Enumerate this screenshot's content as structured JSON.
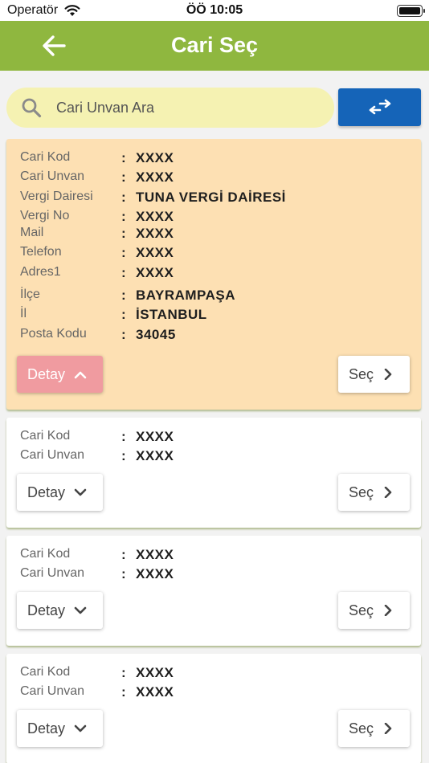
{
  "status_bar": {
    "carrier": "Operatör",
    "time": "ÖÖ 10:05"
  },
  "header": {
    "title": "Cari Seç"
  },
  "search": {
    "placeholder": "Cari Unvan Ara",
    "value": ""
  },
  "colon": ":",
  "buttons": {
    "detail": "Detay",
    "select": "Seç"
  },
  "colors": {
    "header": "#8fb73f",
    "search_bg": "#f5f2b2",
    "swap_button": "#1564b8",
    "expanded_card": "#fde0b3",
    "detail_active": "#f09ba0"
  },
  "icons": {
    "back": "arrow-left-icon",
    "search": "search-icon",
    "swap": "swap-arrows-icon",
    "expand": "chevron-down-icon",
    "collapse": "chevron-up-icon",
    "select": "chevron-right-icon"
  },
  "cards": [
    {
      "expanded": true,
      "fields": [
        {
          "label": "Cari Kod",
          "value": "XXXX"
        },
        {
          "label": "Cari Unvan",
          "value": "XXXX"
        },
        {
          "label": "Vergi Dairesi",
          "value": "TUNA VERGİ DAİRESİ"
        },
        {
          "label": "Vergi No",
          "value": "XXXX"
        },
        {
          "label": "Mail",
          "value": "XXXX"
        },
        {
          "label": "Telefon",
          "value": "XXXX"
        },
        {
          "label": "Adres1",
          "value": "XXXX"
        },
        {
          "label": "İlçe",
          "value": "BAYRAMPAŞA"
        },
        {
          "label": "İl",
          "value": "İSTANBUL"
        },
        {
          "label": "Posta Kodu",
          "value": "34045"
        }
      ]
    },
    {
      "expanded": false,
      "fields": [
        {
          "label": "Cari Kod",
          "value": "XXXX"
        },
        {
          "label": "Cari Unvan",
          "value": "XXXX"
        }
      ]
    },
    {
      "expanded": false,
      "fields": [
        {
          "label": "Cari Kod",
          "value": "XXXX"
        },
        {
          "label": "Cari Unvan",
          "value": "XXXX"
        }
      ]
    },
    {
      "expanded": false,
      "fields": [
        {
          "label": "Cari Kod",
          "value": "XXXX"
        },
        {
          "label": "Cari Unvan",
          "value": "XXXX"
        }
      ]
    }
  ]
}
